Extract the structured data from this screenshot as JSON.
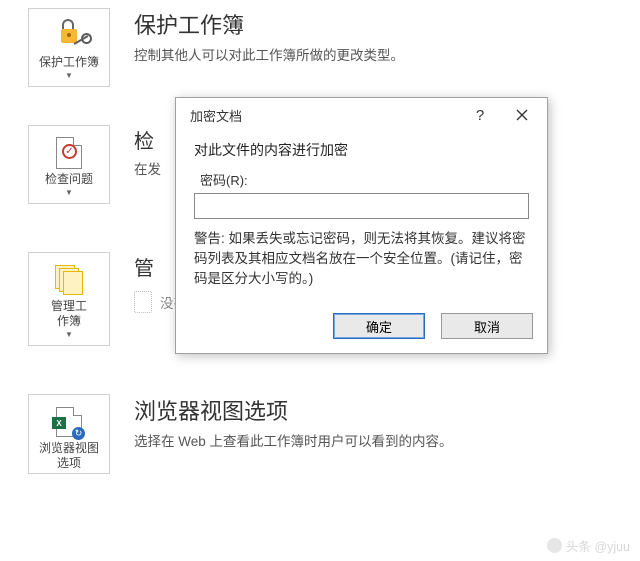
{
  "sections": {
    "protect": {
      "tile_label": "保护工作簿",
      "heading": "保护工作簿",
      "desc": "控制其他人可以对此工作簿所做的更改类型。"
    },
    "inspect": {
      "tile_label": "检查问题",
      "heading_partial": "检",
      "desc_partial": "在发"
    },
    "manage": {
      "tile_label": "管理工\n作簿",
      "heading_partial": "管",
      "sub_text": "没有任何未保存的更改。"
    },
    "browser": {
      "tile_label": "浏览器视图\n选项",
      "heading": "浏览器视图选项",
      "desc": "选择在 Web 上查看此工作簿时用户可以看到的内容。"
    }
  },
  "dialog": {
    "title": "加密文档",
    "help_symbol": "?",
    "heading": "对此文件的内容进行加密",
    "password_label": "密码(R):",
    "password_value": "",
    "warning": "警告: 如果丢失或忘记密码，则无法将其恢复。建议将密码列表及其相应文档名放在一个安全位置。(请记住，密码是区分大小写的。)",
    "ok": "确定",
    "cancel": "取消"
  },
  "watermark": "头条 @yjuu"
}
